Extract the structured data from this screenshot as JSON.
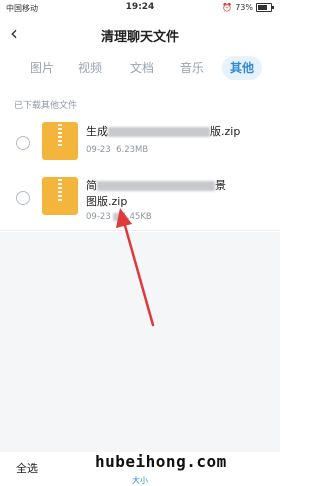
{
  "status_bar": {
    "carrier": "中国移动",
    "time": "19:24",
    "battery_text": "73%",
    "battery_level": 0.73
  },
  "nav": {
    "back_icon": "chevron-left-icon",
    "title": "清理聊天文件"
  },
  "tabs": [
    {
      "label": "图片",
      "active": false
    },
    {
      "label": "视频",
      "active": false
    },
    {
      "label": "文档",
      "active": false
    },
    {
      "label": "音乐",
      "active": false
    },
    {
      "label": "其他",
      "active": true
    }
  ],
  "section_label": "已下载其他文件",
  "files": [
    {
      "name_prefix": "生成",
      "name_suffix": "版.zip",
      "date": "09-23",
      "size": "6.23MB"
    },
    {
      "name_prefix": "简",
      "name_suffix": "景",
      "name_line2": "图版.zip",
      "date": "09-23",
      "size": "1.45KB"
    }
  ],
  "bottom_bar": {
    "select_all": "全选",
    "sort_label": "大小"
  },
  "watermark": "hubeihong.com",
  "accent_color": "#2f8ad6",
  "arrow_color": "#e0393b"
}
